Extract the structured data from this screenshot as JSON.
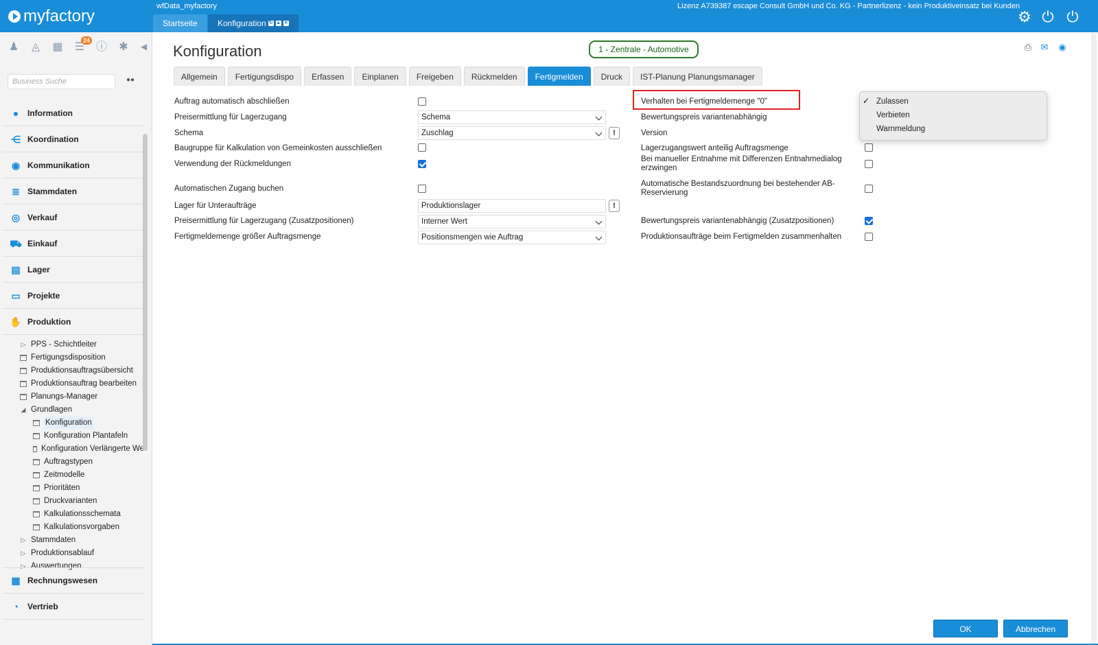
{
  "app": {
    "logo_text": "myfactory",
    "db_name": "wfData_myfactory",
    "license": "Lizenz A739387 escape Consult GmbH und Co. KG - Partnerlizenz - kein Produktiveinsatz bei Kunden"
  },
  "top_tabs": [
    {
      "label": "Startseite"
    },
    {
      "label": "Konfiguration"
    }
  ],
  "sidebar": {
    "badge_count": "24",
    "search_placeholder": "Business Suche",
    "nav": [
      {
        "label": "Information",
        "icon": "info-icon"
      },
      {
        "label": "Koordination",
        "icon": "network-icon"
      },
      {
        "label": "Kommunikation",
        "icon": "chat-icon"
      },
      {
        "label": "Stammdaten",
        "icon": "database-icon"
      },
      {
        "label": "Verkauf",
        "icon": "coins-icon"
      },
      {
        "label": "Einkauf",
        "icon": "cart-icon"
      },
      {
        "label": "Lager",
        "icon": "warehouse-icon"
      },
      {
        "label": "Projekte",
        "icon": "presentation-icon"
      },
      {
        "label": "Produktion",
        "icon": "hand-gear-icon"
      },
      {
        "label": "Rechnungswesen",
        "icon": "grid-icon"
      },
      {
        "label": "Vertrieb",
        "icon": "gauge-icon"
      }
    ],
    "tree": [
      {
        "label": "PPS - Schichtleiter"
      },
      {
        "label": "Fertigungsdisposition"
      },
      {
        "label": "Produktionsauftragsübersicht"
      },
      {
        "label": "Produktionsauftrag bearbeiten"
      },
      {
        "label": "Planungs-Manager"
      },
      {
        "label": "Grundlagen"
      },
      {
        "label": "Konfiguration"
      },
      {
        "label": "Konfiguration Plantafeln"
      },
      {
        "label": "Konfiguration Verlängerte We"
      },
      {
        "label": "Auftragstypen"
      },
      {
        "label": "Zeitmodelle"
      },
      {
        "label": "Prioritäten"
      },
      {
        "label": "Druckvarianten"
      },
      {
        "label": "Kalkulationsschemata"
      },
      {
        "label": "Kalkulationsvorgaben"
      },
      {
        "label": "Stammdaten"
      },
      {
        "label": "Produktionsablauf"
      },
      {
        "label": "Auswertungen"
      }
    ]
  },
  "main": {
    "title": "Konfiguration",
    "context": "1 - Zentrale - Automotive",
    "tabs": [
      {
        "label": "Allgemein"
      },
      {
        "label": "Fertigungsdispo"
      },
      {
        "label": "Erfassen"
      },
      {
        "label": "Einplanen"
      },
      {
        "label": "Freigeben"
      },
      {
        "label": "Rückmelden"
      },
      {
        "label": "Fertigmelden"
      },
      {
        "label": "Druck"
      },
      {
        "label": "IST-Planung Planungsmanager"
      }
    ],
    "left_fields": {
      "auftrag_abschliessen": "Auftrag automatisch abschließen",
      "preisermittlung": "Preisermittlung für Lagerzugang",
      "preisermittlung_value": "Schema",
      "schema": "Schema",
      "schema_value": "Zuschlag",
      "baugruppe": "Baugruppe für Kalkulation von Gemeinkosten ausschließen",
      "rueckmeldungen": "Verwendung der Rückmeldungen",
      "zugang_buchen": "Automatischen Zugang buchen",
      "lager": "Lager für Unteraufträge",
      "lager_value": "Produktionslager",
      "preis_zusatz": "Preisermittlung für Lagerzugang (Zusatzpositionen)",
      "preis_zusatz_value": "Interner Wert",
      "menge_groesser": "Fertigmeldemenge größer Auftragsmenge",
      "menge_groesser_value": "Positionsmengen wie Auftrag"
    },
    "right_fields": {
      "verhalten": "Verhalten bei Fertigmeldemenge \"0\"",
      "bewertung": "Bewertungspreis variantenabhängig",
      "version": "Version",
      "lagerzugangswert": "Lagerzugangswert anteilig Auftragsmenge",
      "entnahme": "Bei manueller Entnahme mit Differenzen Entnahmedialog erzwingen",
      "bestand": "Automatische Bestandszuordnung bei bestehender AB-Reservierung",
      "bewertung_zusatz": "Bewertungspreis variantenabhängig (Zusatzpositionen)",
      "zusammenhalten": "Produktionsaufträge beim Fertigmelden zusammenhalten"
    },
    "dropdown": {
      "options": [
        "Zulassen",
        "Verbieten",
        "Warnmeldung"
      ],
      "selected": "Zulassen",
      "check": "✓"
    },
    "buttons": {
      "ok": "OK",
      "cancel": "Abbrechen"
    }
  },
  "colors": {
    "accent": "#1a8dd8",
    "highlight": "#e02020",
    "context_border": "#2d7a2d"
  }
}
